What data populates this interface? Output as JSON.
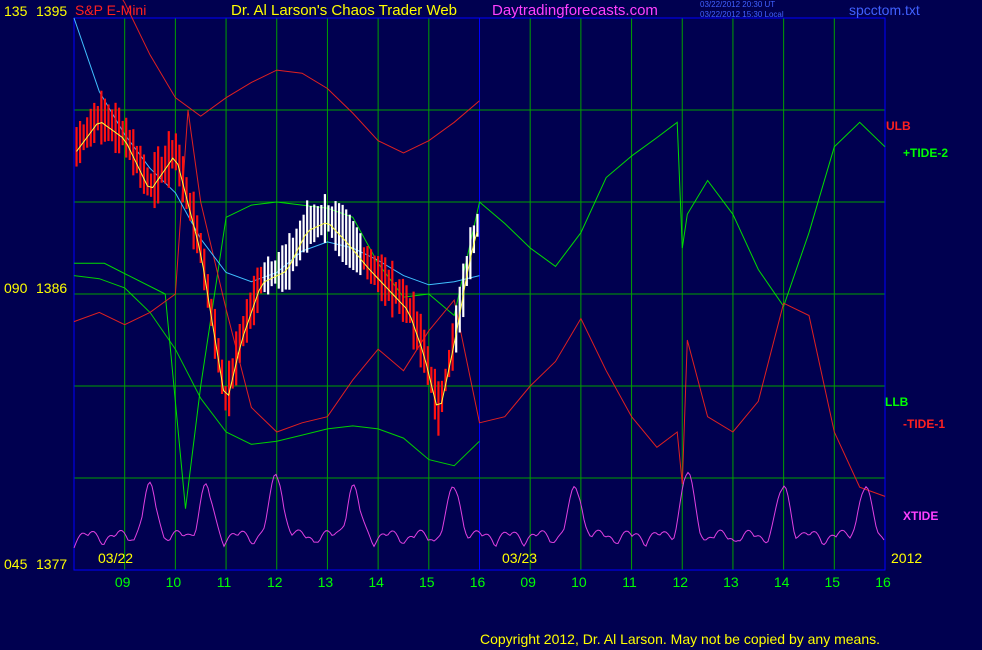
{
  "header": {
    "instrument": "S&P E-Mini",
    "site_title": "Dr. Al Larson's Chaos Trader Web",
    "site_url": "Daytradingforecasts.com",
    "stamp_ut": "03/22/2012 20:30 UT",
    "stamp_local": "03/22/2012 15:30 Local",
    "file_name": "spcctom.txt"
  },
  "copyright": "Copyright 2012, Dr. Al Larson. May not be copied by any means.",
  "colors": {
    "background": "#000050",
    "grid": "#00a000",
    "white_text": "#ffffff",
    "yellow_text": "#ffff00",
    "green_text": "#00ff00",
    "red_text": "#ff2020",
    "magenta_text": "#ff40ff",
    "blue_text": "#4060ff",
    "ulb_band": "#e02020",
    "llb_band": "#00d000",
    "tide_plus": "#00dd00",
    "tide_minus": "#e02020",
    "xtide": "#e040e0",
    "ma_fast": "#ffff40",
    "ma_slow": "#40c0ff",
    "bar_down": "#ff1010",
    "bar_up": "#ffffff"
  },
  "chart_data": {
    "type": "line",
    "title": "S&P E-Mini",
    "y_axis": {
      "tick_labels": [
        {
          "pct": "135",
          "price": "1395"
        },
        {
          "pct": "090",
          "price": "1386"
        },
        {
          "pct": "045",
          "price": "1377"
        }
      ],
      "ylim": [
        1377,
        1395
      ]
    },
    "x_axis": {
      "session_labels": [
        "03/22",
        "03/23"
      ],
      "year_label": "2012",
      "hour_labels": [
        "09",
        "10",
        "11",
        "12",
        "13",
        "14",
        "15",
        "16",
        "09",
        "10",
        "11",
        "12",
        "13",
        "14",
        "15",
        "16"
      ]
    },
    "series_labels": [
      {
        "name": "ULB",
        "color": "#ff2020"
      },
      {
        "name": "+TIDE-2",
        "color": "#00ff00"
      },
      {
        "name": "LLB",
        "color": "#00ff00"
      },
      {
        "name": "-TIDE-1",
        "color": "#ff2020"
      },
      {
        "name": "XTIDE",
        "color": "#ff40ff"
      }
    ],
    "series": [
      {
        "key": "ulb",
        "x": [
          0,
          0.5,
          1,
          1.5,
          2,
          2.5,
          3,
          3.5,
          4,
          4.5,
          5,
          5.5,
          6,
          6.5,
          7,
          7.5,
          8
        ],
        "values": [
          1399.5,
          1396.8,
          1395.5,
          1393.8,
          1392.4,
          1391.8,
          1392.4,
          1392.9,
          1393.3,
          1393.2,
          1392.7,
          1391.9,
          1391.0,
          1390.6,
          1391.0,
          1391.6,
          1392.3
        ]
      },
      {
        "key": "llb",
        "x": [
          0,
          0.5,
          1,
          1.5,
          2,
          2.5,
          3,
          3.5,
          4,
          4.5,
          5,
          5.5,
          6,
          6.5,
          7,
          7.5,
          8
        ],
        "values": [
          1386.6,
          1386.5,
          1386.2,
          1385.4,
          1384.2,
          1382.6,
          1381.5,
          1381.1,
          1381.2,
          1381.4,
          1381.6,
          1381.7,
          1381.6,
          1381.3,
          1380.6,
          1380.4,
          1381.2
        ]
      },
      {
        "key": "tide_plus",
        "x": [
          0,
          0.6,
          1.2,
          1.8,
          2.2,
          2.5,
          3,
          3.5,
          4,
          4.5,
          5,
          5.5,
          6,
          6.5,
          7,
          7.5,
          8,
          8.5,
          9,
          9.5,
          10,
          10.5,
          11,
          11.5,
          11.9,
          12,
          12.1,
          12.5,
          13,
          13.5,
          14,
          14.5,
          15,
          15.5,
          16
        ],
        "values": [
          1387.0,
          1387.0,
          1386.5,
          1386.0,
          1379.0,
          1383.0,
          1388.5,
          1388.9,
          1389.0,
          1388.9,
          1388.8,
          1388.5,
          1387.0,
          1385.9,
          1386.0,
          1385.3,
          1389.0,
          1388.3,
          1387.5,
          1386.9,
          1388.0,
          1389.8,
          1390.5,
          1391.1,
          1391.6,
          1387.5,
          1388.6,
          1389.7,
          1388.6,
          1386.8,
          1385.6,
          1388.0,
          1390.8,
          1391.6,
          1390.8
        ]
      },
      {
        "key": "tide_minus",
        "x": [
          0,
          0.5,
          1,
          1.5,
          2,
          2.25,
          2.5,
          3,
          3.5,
          4,
          4.5,
          5,
          5.5,
          6,
          6.5,
          7,
          7.5,
          8,
          8.5,
          9,
          9.5,
          10,
          10.5,
          11,
          11.5,
          11.9,
          12,
          12.1,
          12.5,
          13,
          13.5,
          14,
          14.5,
          15,
          15.5,
          16
        ],
        "values": [
          1385.1,
          1385.4,
          1385.0,
          1385.4,
          1386.0,
          1392.0,
          1389.0,
          1385.5,
          1382.3,
          1381.5,
          1381.8,
          1382.0,
          1383.2,
          1384.2,
          1383.5,
          1384.8,
          1385.8,
          1381.8,
          1382.0,
          1383.0,
          1383.8,
          1385.2,
          1383.5,
          1382.0,
          1381.0,
          1381.5,
          1379.8,
          1384.5,
          1382.0,
          1381.5,
          1382.5,
          1385.7,
          1385.3,
          1381.5,
          1379.7,
          1379.4
        ]
      },
      {
        "key": "ma_slow",
        "x": [
          0,
          0.5,
          1,
          1.5,
          2,
          2.5,
          3,
          3.5,
          4,
          4.5,
          5,
          5.5,
          6,
          6.5,
          7,
          7.5,
          8
        ],
        "values": [
          1395.0,
          1392.6,
          1391.2,
          1390.1,
          1389.3,
          1387.8,
          1386.7,
          1386.4,
          1386.7,
          1387.4,
          1387.7,
          1387.5,
          1387.1,
          1386.6,
          1386.3,
          1386.4,
          1386.6
        ]
      }
    ],
    "price_bars": {
      "x_range": [
        0,
        8
      ],
      "low_point": "11:00 on 03/22",
      "close_at_16": 1388.5
    },
    "oscillator": {
      "key": "xtide",
      "peaks_at_hours": [
        1.5,
        2.6,
        4.0,
        5.5,
        7.5,
        9.9,
        12.1,
        14.0,
        15.6
      ]
    }
  }
}
